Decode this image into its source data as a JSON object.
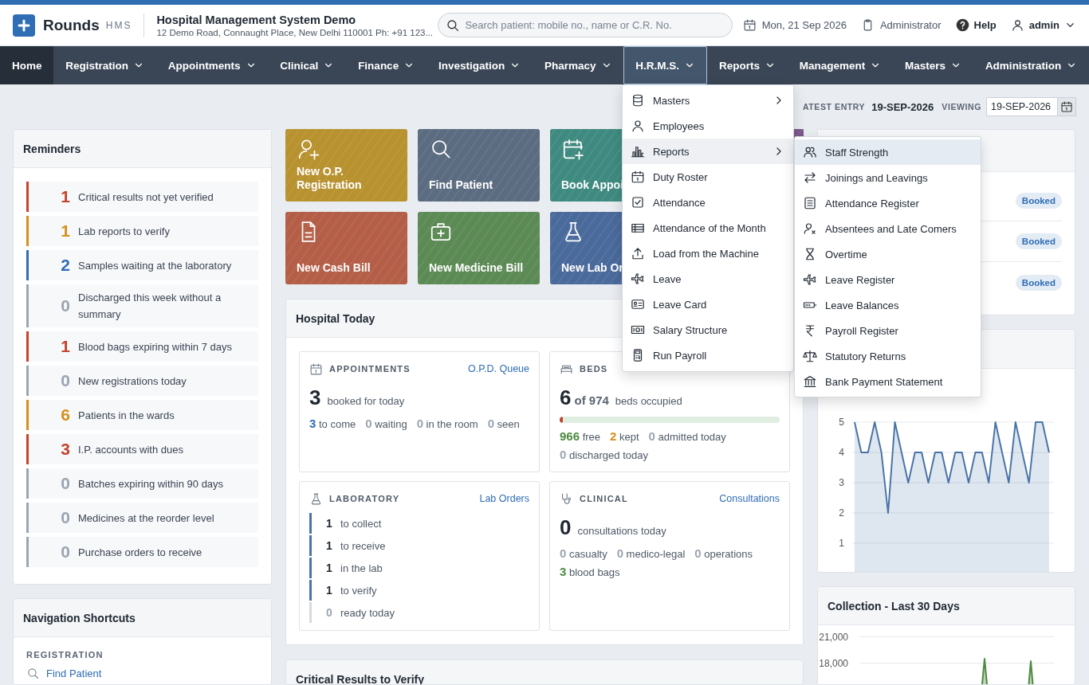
{
  "header": {
    "brand": "Rounds",
    "brand_suffix": "HMS",
    "hospital_name": "Hospital Management System Demo",
    "address": "12 Demo Road, Connaught Place, New Delhi 110001 Ph: +91 123...",
    "search": {
      "placeholder": "Search patient: mobile no., name or C.R. No."
    },
    "date": "Mon, 21 Sep 2026",
    "role": "Administrator",
    "help": "Help",
    "user": "admin"
  },
  "nav": [
    {
      "label": "Home",
      "kind": "link",
      "selected": true,
      "expanded": false
    },
    {
      "label": "Registration",
      "kind": "dropdown",
      "selected": false,
      "expanded": false
    },
    {
      "label": "Appointments",
      "kind": "dropdown",
      "selected": false,
      "expanded": false
    },
    {
      "label": "Clinical",
      "kind": "dropdown",
      "selected": false,
      "expanded": false
    },
    {
      "label": "Finance",
      "kind": "dropdown",
      "selected": false,
      "expanded": false
    },
    {
      "label": "Investigation",
      "kind": "dropdown",
      "selected": false,
      "expanded": false
    },
    {
      "label": "Pharmacy",
      "kind": "dropdown",
      "selected": false,
      "expanded": false
    },
    {
      "label": "H.R.M.S.",
      "kind": "dropdown",
      "selected": false,
      "expanded": true
    },
    {
      "label": "Reports",
      "kind": "dropdown",
      "selected": false,
      "expanded": false
    },
    {
      "label": "Management",
      "kind": "dropdown",
      "selected": false,
      "expanded": false
    },
    {
      "label": "Masters",
      "kind": "dropdown",
      "selected": false,
      "expanded": false
    },
    {
      "label": "Administration",
      "kind": "dropdown",
      "selected": false,
      "expanded": false
    }
  ],
  "hrms_menu": {
    "items": [
      {
        "label": "Masters",
        "submenu": true,
        "selected": false
      },
      {
        "label": "Employees",
        "submenu": false,
        "selected": false
      },
      {
        "label": "Reports",
        "submenu": true,
        "selected": true
      },
      {
        "label": "Duty Roster",
        "submenu": false,
        "selected": false
      },
      {
        "label": "Attendance",
        "submenu": false,
        "selected": false
      },
      {
        "label": "Attendance of the Month",
        "submenu": false,
        "selected": false
      },
      {
        "label": "Load from the Machine",
        "submenu": false,
        "selected": false
      },
      {
        "label": "Leave",
        "submenu": false,
        "selected": false
      },
      {
        "label": "Leave Card",
        "submenu": false,
        "selected": false
      },
      {
        "label": "Salary Structure",
        "submenu": false,
        "selected": false
      },
      {
        "label": "Run Payroll",
        "submenu": false,
        "selected": false
      }
    ],
    "submenu": [
      {
        "label": "Staff Strength",
        "selected": true
      },
      {
        "label": "Joinings and Leavings",
        "selected": false
      },
      {
        "label": "Attendance Register",
        "selected": false
      },
      {
        "label": "Absentees and Late Comers",
        "selected": false
      },
      {
        "label": "Overtime",
        "selected": false
      },
      {
        "label": "Leave Register",
        "selected": false
      },
      {
        "label": "Leave Balances",
        "selected": false
      },
      {
        "label": "Payroll Register",
        "selected": false
      },
      {
        "label": "Statutory Returns",
        "selected": false
      },
      {
        "label": "Bank Payment Statement",
        "selected": false
      }
    ]
  },
  "toolbar": {
    "latest_label": "ATEST ENTRY",
    "latest_date": "19-SEP-2026",
    "viewing_label": "VIEWING",
    "viewing": {
      "value": "19-SEP-2026"
    }
  },
  "reminders": {
    "title": "Reminders",
    "items": [
      {
        "count": "1",
        "text": "Critical results not yet verified",
        "color": "#c4432d"
      },
      {
        "count": "1",
        "text": "Lab reports to verify",
        "color": "#d4901a"
      },
      {
        "count": "2",
        "text": "Samples waiting at the laboratory",
        "color": "#2f6db5"
      },
      {
        "count": "0",
        "text": "Discharged this week without a summary",
        "color": "#9aa5b1"
      },
      {
        "count": "1",
        "text": "Blood bags expiring within 7 days",
        "color": "#c4432d"
      },
      {
        "count": "0",
        "text": "New registrations today",
        "color": "#9aa5b1"
      },
      {
        "count": "6",
        "text": "Patients in the wards",
        "color": "#d4901a"
      },
      {
        "count": "3",
        "text": "I.P. accounts with dues",
        "color": "#c4432d"
      },
      {
        "count": "0",
        "text": "Batches expiring within 90 days",
        "color": "#9aa5b1"
      },
      {
        "count": "0",
        "text": "Medicines at the reorder level",
        "color": "#9aa5b1"
      },
      {
        "count": "0",
        "text": "Purchase orders to receive",
        "color": "#9aa5b1"
      }
    ]
  },
  "shortcuts": {
    "title": "Navigation Shortcuts",
    "section": "REGISTRATION",
    "links": [
      "Find Patient"
    ]
  },
  "tiles": [
    {
      "label": "New O.P. Registration",
      "color": "#b8922f"
    },
    {
      "label": "Find Patient",
      "color": "#5b6b80"
    },
    {
      "label": "Book Appoi",
      "color": "#3f8a80"
    },
    {
      "color": "#7d5a8c"
    },
    {
      "label": "New Cash Bill",
      "color": "#b45e47"
    },
    {
      "label": "New Medicine Bill",
      "color": "#5c8a55"
    },
    {
      "label": "New Lab Or",
      "color": "#4a6a9c"
    }
  ],
  "hospital_today": {
    "title": "Hospital Today",
    "appointments": {
      "title": "APPOINTMENTS",
      "link": "O.P.D. Queue",
      "total": "3",
      "total_label": "booked for today",
      "stats": [
        {
          "count": "3",
          "text": "to come",
          "color": "#2f6db5"
        },
        {
          "count": "0",
          "text": "waiting",
          "color": "#9aa5b1"
        },
        {
          "count": "0",
          "text": "in the room",
          "color": "#9aa5b1"
        },
        {
          "count": "0",
          "text": "seen",
          "color": "#9aa5b1"
        }
      ]
    },
    "beds": {
      "title": "BEDS",
      "total": "6",
      "capacity": "of 974",
      "total_label": "beds occupied",
      "level": 0.015,
      "stats": [
        {
          "count": "966",
          "text": "free",
          "color": "#4c8a3f"
        },
        {
          "count": "2",
          "text": "kept",
          "color": "#d4901a"
        },
        {
          "count": "0",
          "text": "admitted today",
          "color": "#9aa5b1"
        },
        {
          "count": "0",
          "text": "discharged today",
          "color": "#9aa5b1"
        }
      ]
    },
    "laboratory": {
      "title": "LABORATORY",
      "link": "Lab Orders",
      "items": [
        {
          "count": "1",
          "text": "to collect",
          "active": true
        },
        {
          "count": "1",
          "text": "to receive",
          "active": true
        },
        {
          "count": "1",
          "text": "in the lab",
          "active": true
        },
        {
          "count": "1",
          "text": "to verify",
          "active": true
        },
        {
          "count": "0",
          "text": "ready today",
          "active": false
        }
      ]
    },
    "clinical": {
      "title": "CLINICAL",
      "link": "Consultations",
      "total": "0",
      "total_label": "consultations today",
      "stats": [
        {
          "count": "0",
          "text": "casualty",
          "color": "#9aa5b1"
        },
        {
          "count": "0",
          "text": "medico-legal",
          "color": "#9aa5b1"
        },
        {
          "count": "0",
          "text": "operations",
          "color": "#9aa5b1"
        },
        {
          "count": "3",
          "text": "blood bags",
          "color": "#4c8a3f"
        }
      ]
    }
  },
  "critical_results": {
    "title": "Critical Results to Verify"
  },
  "bookings": {
    "rows": [
      {
        "status": "Booked"
      },
      {
        "status": "Booked"
      },
      {
        "status": "Booked"
      }
    ]
  },
  "attendance_chart": {
    "chart_data": {
      "type": "area",
      "grid": true,
      "ylim": [
        1,
        5
      ],
      "yticks": [
        1,
        2,
        3,
        4,
        5
      ],
      "series": [
        {
          "color": "#4a74a8",
          "values": [
            5,
            4,
            4,
            5,
            4,
            2,
            5,
            4,
            3,
            4,
            4,
            3,
            4,
            4,
            3,
            4,
            4,
            3,
            4,
            4,
            3,
            5,
            4,
            3,
            5,
            4,
            3,
            5,
            5,
            4
          ]
        }
      ]
    }
  },
  "collection": {
    "title": "Collection - Last 30 Days",
    "axis_labels": [
      "21,000",
      "18,000"
    ]
  }
}
